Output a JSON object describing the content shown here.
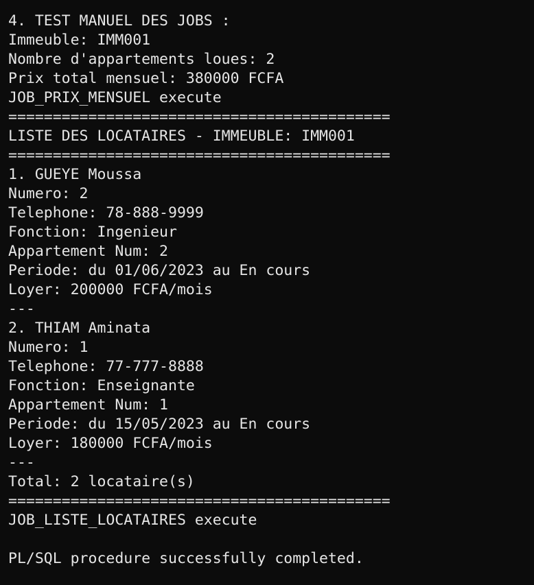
{
  "terminal": {
    "lines": [
      "4. TEST MANUEL DES JOBS :",
      "Immeuble: IMM001",
      "Nombre d'appartements loues: 2",
      "Prix total mensuel: 380000 FCFA",
      "JOB_PRIX_MENSUEL execute",
      "===========================================",
      "LISTE DES LOCATAIRES - IMMEUBLE: IMM001",
      "===========================================",
      "1. GUEYE Moussa",
      "Numero: 2",
      "Telephone: 78-888-9999",
      "Fonction: Ingenieur",
      "Appartement Num: 2",
      "Periode: du 01/06/2023 au En cours",
      "Loyer: 200000 FCFA/mois",
      "---",
      "2. THIAM Aminata",
      "Numero: 1",
      "Telephone: 77-777-8888",
      "Fonction: Enseignante",
      "Appartement Num: 1",
      "Periode: du 15/05/2023 au En cours",
      "Loyer: 180000 FCFA/mois",
      "---",
      "Total: 2 locataire(s)",
      "===========================================",
      "JOB_LISTE_LOCATAIRES execute",
      "",
      "PL/SQL procedure successfully completed."
    ]
  }
}
